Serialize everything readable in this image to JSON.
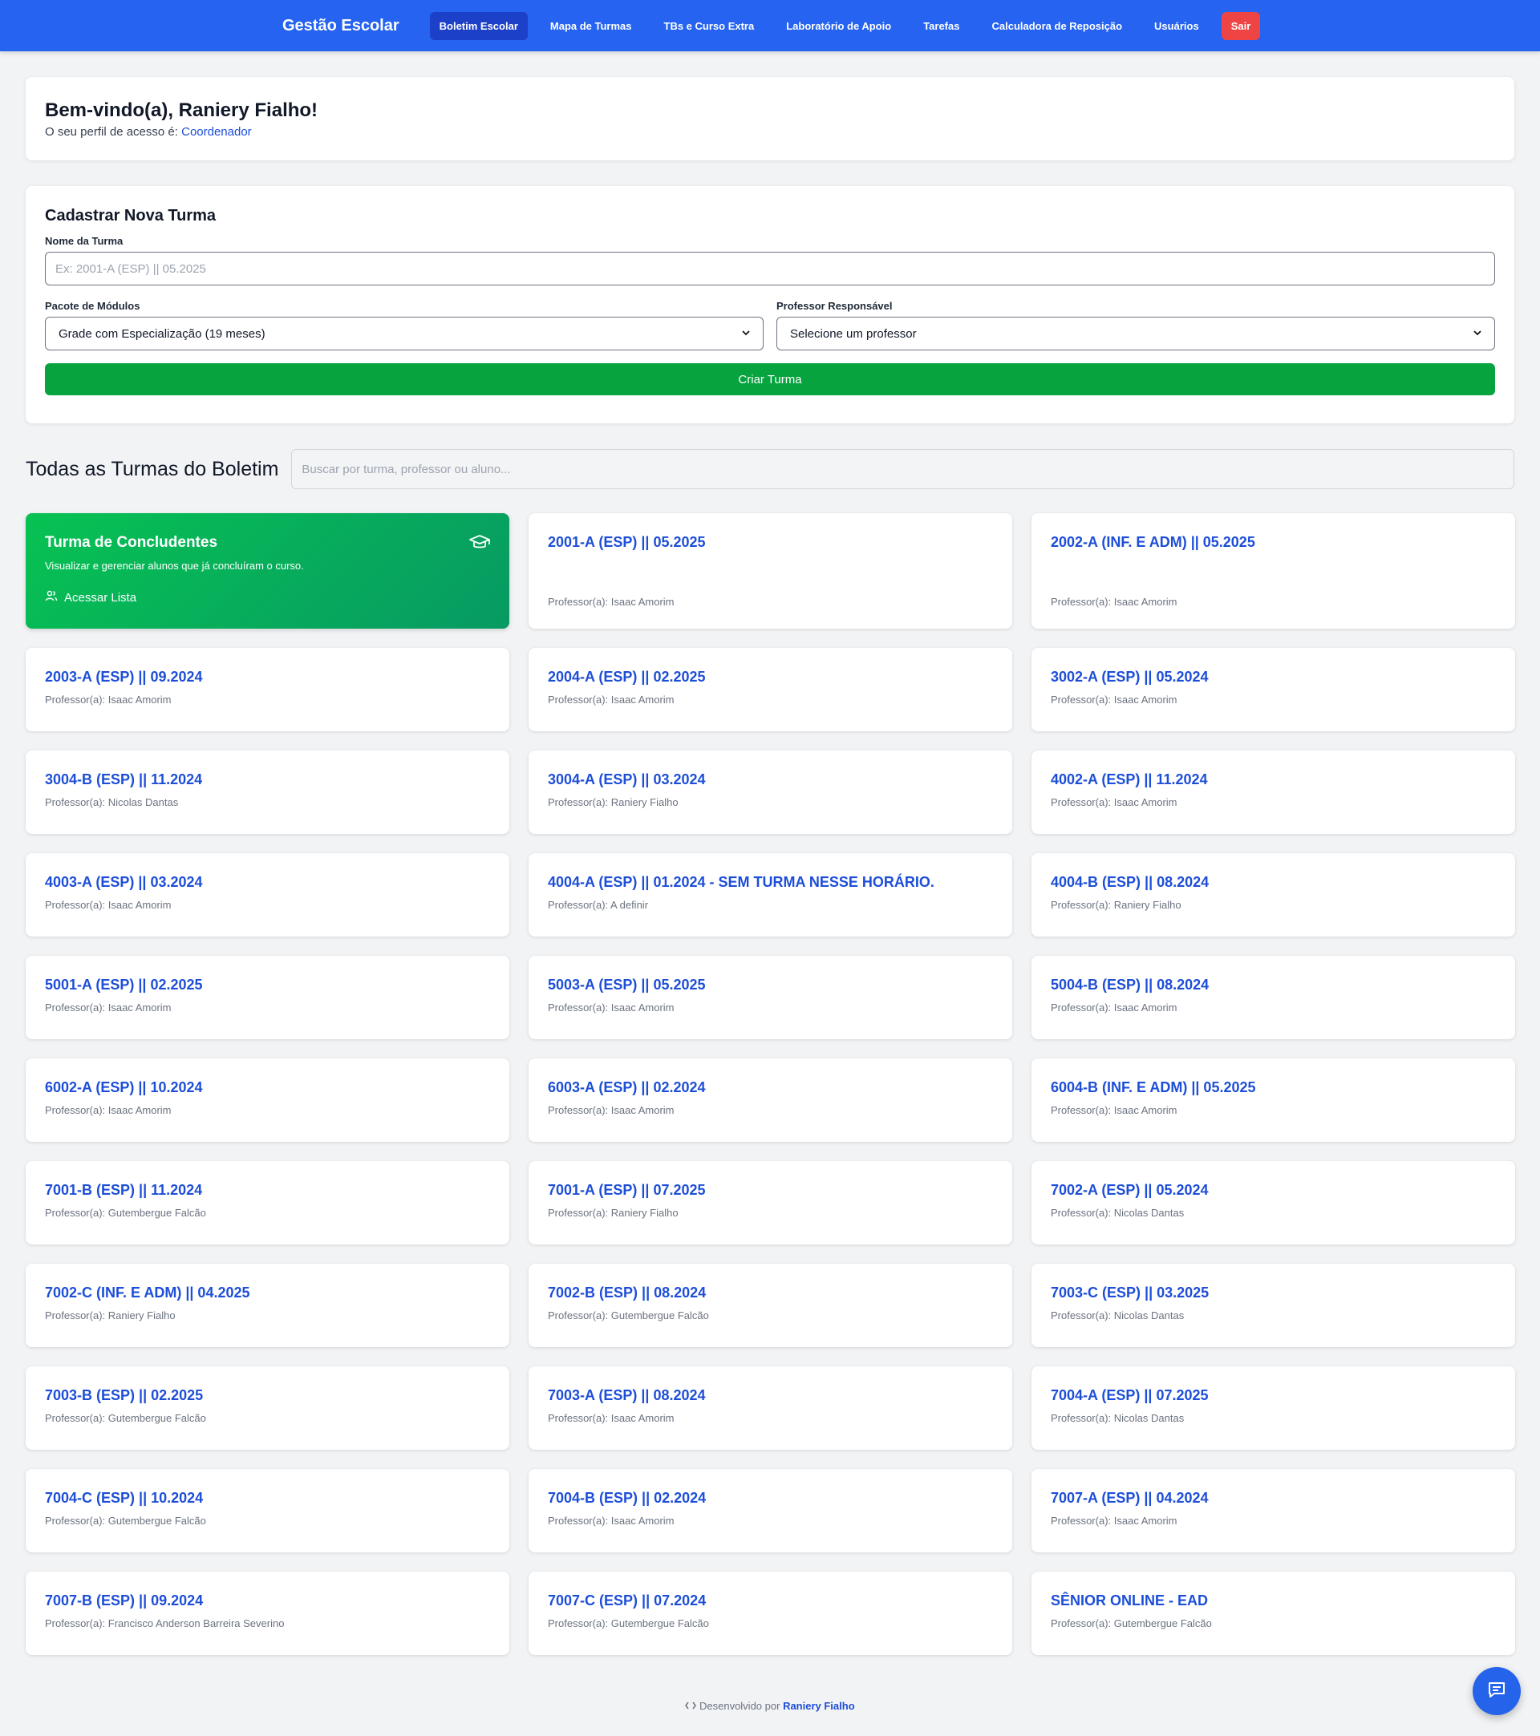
{
  "nav": {
    "brand": "Gestão Escolar",
    "items": [
      {
        "label": "Boletim Escolar",
        "active": true
      },
      {
        "label": "Mapa de Turmas"
      },
      {
        "label": "TBs e Curso Extra"
      },
      {
        "label": "Laboratório de Apoio"
      },
      {
        "label": "Tarefas"
      },
      {
        "label": "Calculadora de Reposição"
      },
      {
        "label": "Usuários"
      }
    ],
    "logout": "Sair",
    "colors": {
      "bar": "#2563f0",
      "active": "#1d40c8",
      "logout": "#ef4444"
    }
  },
  "welcome": {
    "title": "Bem-vindo(a), Raniery Fialho!",
    "profile_prefix": "O seu perfil de acesso é:",
    "role": "Coordenador"
  },
  "form": {
    "title": "Cadastrar Nova Turma",
    "name_label": "Nome da Turma",
    "name_placeholder": "Ex: 2001-A (ESP) || 05.2025",
    "package_label": "Pacote de Módulos",
    "package_value": "Grade com Especialização (19 meses)",
    "teacher_label": "Professor Responsável",
    "teacher_value": "Selecione um professor",
    "submit": "Criar Turma",
    "submit_color": "#06a33f"
  },
  "list": {
    "title": "Todas as Turmas do Boletim",
    "search_placeholder": "Buscar por turma, professor ou aluno...",
    "graduates": {
      "title": "Turma de Concludentes",
      "description": "Visualizar e gerenciar alunos que já concluíram o curso.",
      "action": "Acessar Lista",
      "icon": "graduation-cap-icon"
    },
    "prof_prefix": "Professor(a):",
    "turmas": [
      {
        "name": "2001-A (ESP) || 05.2025",
        "professor": "Isaac Amorim"
      },
      {
        "name": "2002-A (INF. E ADM) || 05.2025",
        "professor": "Isaac Amorim"
      },
      {
        "name": "2003-A (ESP) || 09.2024",
        "professor": "Isaac Amorim"
      },
      {
        "name": "2004-A (ESP) || 02.2025",
        "professor": "Isaac Amorim"
      },
      {
        "name": "3002-A (ESP) || 05.2024",
        "professor": "Isaac Amorim"
      },
      {
        "name": "3004-B (ESP) || 11.2024",
        "professor": "Nicolas Dantas"
      },
      {
        "name": "3004-A (ESP) || 03.2024",
        "professor": "Raniery Fialho"
      },
      {
        "name": "4002-A (ESP) || 11.2024",
        "professor": "Isaac Amorim"
      },
      {
        "name": "4003-A (ESP) || 03.2024",
        "professor": "Isaac Amorim"
      },
      {
        "name": "4004-A (ESP) || 01.2024 - SEM TURMA NESSE HORÁRIO.",
        "professor": "A definir"
      },
      {
        "name": "4004-B (ESP) || 08.2024",
        "professor": "Raniery Fialho"
      },
      {
        "name": "5001-A (ESP) || 02.2025",
        "professor": "Isaac Amorim"
      },
      {
        "name": "5003-A (ESP) || 05.2025",
        "professor": "Isaac Amorim"
      },
      {
        "name": "5004-B (ESP) || 08.2024",
        "professor": "Isaac Amorim"
      },
      {
        "name": "6002-A (ESP) || 10.2024",
        "professor": "Isaac Amorim"
      },
      {
        "name": "6003-A (ESP) || 02.2024",
        "professor": "Isaac Amorim"
      },
      {
        "name": "6004-B (INF. E ADM) || 05.2025",
        "professor": "Isaac Amorim"
      },
      {
        "name": "7001-B (ESP) || 11.2024",
        "professor": "Gutembergue Falcão"
      },
      {
        "name": "7001-A (ESP) || 07.2025",
        "professor": "Raniery Fialho"
      },
      {
        "name": "7002-A (ESP) || 05.2024",
        "professor": "Nicolas Dantas"
      },
      {
        "name": "7002-C (INF. E ADM) || 04.2025",
        "professor": "Raniery Fialho"
      },
      {
        "name": "7002-B (ESP) || 08.2024",
        "professor": "Gutembergue Falcão"
      },
      {
        "name": "7003-C (ESP) || 03.2025",
        "professor": "Nicolas Dantas"
      },
      {
        "name": "7003-B (ESP) || 02.2025",
        "professor": "Gutembergue Falcão"
      },
      {
        "name": "7003-A (ESP) || 08.2024",
        "professor": "Isaac Amorim"
      },
      {
        "name": "7004-A (ESP) || 07.2025",
        "professor": "Nicolas Dantas"
      },
      {
        "name": "7004-C (ESP) || 10.2024",
        "professor": "Gutembergue Falcão"
      },
      {
        "name": "7004-B (ESP) || 02.2024",
        "professor": "Isaac Amorim"
      },
      {
        "name": "7007-A (ESP) || 04.2024",
        "professor": "Isaac Amorim"
      },
      {
        "name": "7007-B (ESP) || 09.2024",
        "professor": "Francisco Anderson Barreira Severino"
      },
      {
        "name": "7007-C (ESP) || 07.2024",
        "professor": "Gutembergue Falcão"
      },
      {
        "name": "SÊNIOR ONLINE - EAD",
        "professor": "Gutembergue Falcão"
      }
    ]
  },
  "footer": {
    "prefix": "Desenvolvido por",
    "author": "Raniery Fialho",
    "icon": "code-icon"
  },
  "chat": {
    "icon": "chat-icon",
    "color": "#2563eb"
  }
}
